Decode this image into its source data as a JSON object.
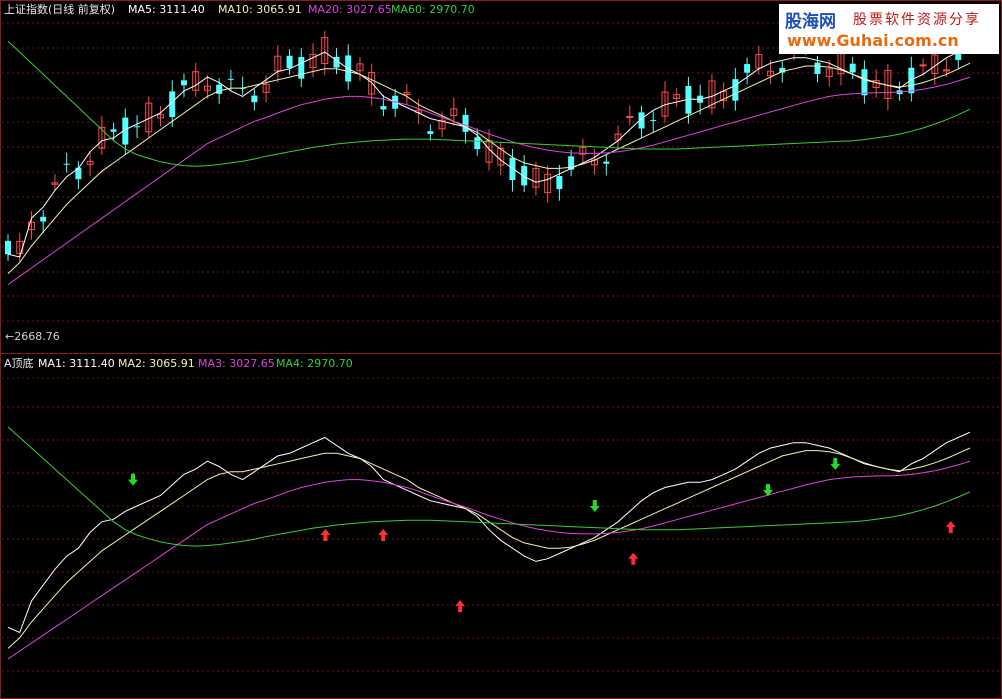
{
  "top_header": {
    "title": "上证指数(日线 前复权)",
    "ma5": "MA5: 3111.40",
    "ma10": "MA10: 3065.91",
    "ma20": "MA20: 3027.65",
    "ma60": "MA60: 2970.70"
  },
  "bottom_header": {
    "title": "A顶底",
    "ma1": "MA1: 3111.40",
    "ma2": "MA2: 3065.91",
    "ma3": "MA3: 3027.65",
    "ma4": "MA4: 2970.70"
  },
  "low_price_label": "←2668.76",
  "watermark": {
    "brand": "股海网",
    "slogan": "股票软件资源分享",
    "url": "www.Guhai.com.cn"
  },
  "colors": {
    "background": "#000000",
    "frame": "#8b1a1a",
    "grid": "#7a1010",
    "up_candle": "#ff4a4a",
    "down_candle": "#54ffff",
    "ma5": "#ffffff",
    "ma10": "#f2f2b0",
    "ma20": "#e040e0",
    "ma60": "#35d035",
    "arrow_up": "#ff3030",
    "arrow_down": "#20e020"
  },
  "chart_data": [
    {
      "type": "candlestick",
      "title": "上证指数(日线 前复权)",
      "price_min_label": 2668.76,
      "ylim": [
        2640,
        3200
      ],
      "series": [
        {
          "name": "MA5",
          "values": [
            2795,
            2790,
            2860,
            2880,
            2910,
            2935,
            2950,
            2980,
            3000,
            3005,
            3020,
            3030,
            3040,
            3050,
            3070,
            3090,
            3100,
            3115,
            3105,
            3090,
            3080,
            3095,
            3110,
            3125,
            3130,
            3140,
            3150,
            3160,
            3145,
            3130,
            3120,
            3105,
            3080,
            3070,
            3060,
            3050,
            3040,
            3035,
            3030,
            3025,
            3010,
            2985,
            2965,
            2950,
            2935,
            2925,
            2930,
            2940,
            2950,
            2960,
            2970,
            2985,
            3000,
            3020,
            3040,
            3055,
            3065,
            3070,
            3075,
            3075,
            3080,
            3090,
            3100,
            3115,
            3130,
            3140,
            3145,
            3150,
            3150,
            3145,
            3140,
            3130,
            3120,
            3110,
            3105,
            3100,
            3095,
            3110,
            3120,
            3135,
            3150,
            3160,
            3170
          ]
        },
        {
          "name": "MA10",
          "values": [
            2760,
            2780,
            2810,
            2835,
            2860,
            2885,
            2905,
            2925,
            2945,
            2960,
            2975,
            2990,
            3005,
            3020,
            3035,
            3050,
            3065,
            3080,
            3090,
            3095,
            3095,
            3100,
            3105,
            3110,
            3115,
            3120,
            3125,
            3130,
            3130,
            3125,
            3120,
            3110,
            3100,
            3090,
            3080,
            3065,
            3055,
            3045,
            3035,
            3025,
            3015,
            3000,
            2985,
            2970,
            2960,
            2955,
            2950,
            2950,
            2952,
            2958,
            2965,
            2975,
            2985,
            2995,
            3005,
            3015,
            3025,
            3035,
            3045,
            3055,
            3065,
            3075,
            3085,
            3095,
            3105,
            3115,
            3125,
            3130,
            3135,
            3135,
            3133,
            3128,
            3120,
            3112,
            3105,
            3100,
            3097,
            3100,
            3105,
            3112,
            3120,
            3130,
            3140
          ]
        },
        {
          "name": "MA20",
          "values": [
            2740,
            2755,
            2770,
            2785,
            2800,
            2815,
            2830,
            2845,
            2860,
            2875,
            2890,
            2905,
            2920,
            2935,
            2950,
            2965,
            2980,
            2995,
            3005,
            3015,
            3025,
            3035,
            3042,
            3050,
            3058,
            3065,
            3070,
            3075,
            3078,
            3080,
            3080,
            3078,
            3075,
            3070,
            3065,
            3058,
            3050,
            3042,
            3035,
            3028,
            3020,
            3012,
            3005,
            2998,
            2992,
            2987,
            2983,
            2980,
            2978,
            2977,
            2977,
            2978,
            2980,
            2983,
            2987,
            2992,
            2998,
            3004,
            3010,
            3016,
            3022,
            3028,
            3034,
            3040,
            3046,
            3052,
            3058,
            3064,
            3070,
            3075,
            3080,
            3083,
            3085,
            3086,
            3087,
            3087,
            3088,
            3090,
            3093,
            3097,
            3102,
            3108,
            3115
          ]
        },
        {
          "name": "MA60",
          "values": [
            3180,
            3160,
            3140,
            3120,
            3100,
            3080,
            3060,
            3040,
            3020,
            3000,
            2985,
            2975,
            2968,
            2962,
            2958,
            2955,
            2954,
            2955,
            2957,
            2960,
            2963,
            2967,
            2972,
            2976,
            2980,
            2984,
            2988,
            2991,
            2994,
            2996,
            2998,
            3000,
            3001,
            3002,
            3003,
            3003,
            3003,
            3002,
            3001,
            3000,
            2999,
            2998,
            2997,
            2996,
            2995,
            2994,
            2993,
            2992,
            2991,
            2990,
            2989,
            2988,
            2987,
            2986,
            2985,
            2985,
            2985,
            2985,
            2986,
            2987,
            2988,
            2989,
            2990,
            2991,
            2992,
            2993,
            2994,
            2995,
            2996,
            2997,
            2998,
            2999,
            3000,
            3002,
            3005,
            3008,
            3012,
            3017,
            3023,
            3030,
            3038,
            3047,
            3057
          ]
        }
      ]
    },
    {
      "type": "line",
      "title": "A顶底",
      "series": [
        {
          "name": "MA1",
          "values": [
            2800,
            2790,
            2850,
            2880,
            2910,
            2935,
            2950,
            2980,
            3000,
            3005,
            3020,
            3030,
            3040,
            3050,
            3070,
            3090,
            3100,
            3115,
            3105,
            3090,
            3080,
            3095,
            3110,
            3125,
            3130,
            3140,
            3150,
            3160,
            3145,
            3130,
            3120,
            3105,
            3080,
            3070,
            3060,
            3050,
            3040,
            3035,
            3030,
            3025,
            3010,
            2985,
            2965,
            2950,
            2935,
            2925,
            2930,
            2940,
            2950,
            2960,
            2970,
            2985,
            3000,
            3020,
            3040,
            3055,
            3065,
            3070,
            3075,
            3075,
            3080,
            3090,
            3100,
            3115,
            3130,
            3140,
            3145,
            3150,
            3150,
            3145,
            3140,
            3130,
            3120,
            3110,
            3105,
            3100,
            3095,
            3110,
            3120,
            3135,
            3150,
            3160,
            3170
          ]
        },
        {
          "name": "MA2",
          "values": [
            2760,
            2780,
            2810,
            2835,
            2860,
            2885,
            2905,
            2925,
            2945,
            2960,
            2975,
            2990,
            3005,
            3020,
            3035,
            3050,
            3065,
            3080,
            3090,
            3095,
            3095,
            3100,
            3105,
            3110,
            3115,
            3120,
            3125,
            3130,
            3130,
            3125,
            3120,
            3110,
            3100,
            3090,
            3080,
            3065,
            3055,
            3045,
            3035,
            3025,
            3015,
            3000,
            2985,
            2970,
            2960,
            2955,
            2950,
            2950,
            2952,
            2958,
            2965,
            2975,
            2985,
            2995,
            3005,
            3015,
            3025,
            3035,
            3045,
            3055,
            3065,
            3075,
            3085,
            3095,
            3105,
            3115,
            3125,
            3130,
            3135,
            3135,
            3133,
            3128,
            3120,
            3112,
            3105,
            3100,
            3097,
            3100,
            3105,
            3112,
            3120,
            3130,
            3140
          ]
        },
        {
          "name": "MA3",
          "values": [
            2740,
            2755,
            2770,
            2785,
            2800,
            2815,
            2830,
            2845,
            2860,
            2875,
            2890,
            2905,
            2920,
            2935,
            2950,
            2965,
            2980,
            2995,
            3005,
            3015,
            3025,
            3035,
            3042,
            3050,
            3058,
            3065,
            3070,
            3075,
            3078,
            3080,
            3080,
            3078,
            3075,
            3070,
            3065,
            3058,
            3050,
            3042,
            3035,
            3028,
            3020,
            3012,
            3005,
            2998,
            2992,
            2987,
            2983,
            2980,
            2978,
            2977,
            2977,
            2978,
            2980,
            2983,
            2987,
            2992,
            2998,
            3004,
            3010,
            3016,
            3022,
            3028,
            3034,
            3040,
            3046,
            3052,
            3058,
            3064,
            3070,
            3075,
            3080,
            3083,
            3085,
            3086,
            3087,
            3087,
            3088,
            3090,
            3093,
            3097,
            3102,
            3108,
            3115
          ]
        },
        {
          "name": "MA4",
          "values": [
            3180,
            3160,
            3140,
            3120,
            3100,
            3080,
            3060,
            3040,
            3020,
            3000,
            2985,
            2975,
            2968,
            2962,
            2958,
            2955,
            2954,
            2955,
            2957,
            2960,
            2963,
            2967,
            2972,
            2976,
            2980,
            2984,
            2988,
            2991,
            2994,
            2996,
            2998,
            3000,
            3001,
            3002,
            3003,
            3003,
            3003,
            3002,
            3001,
            3000,
            2999,
            2998,
            2997,
            2996,
            2995,
            2994,
            2993,
            2992,
            2991,
            2990,
            2989,
            2988,
            2987,
            2986,
            2985,
            2985,
            2985,
            2985,
            2986,
            2987,
            2988,
            2989,
            2990,
            2991,
            2992,
            2993,
            2994,
            2995,
            2996,
            2997,
            2998,
            2999,
            3000,
            3002,
            3005,
            3008,
            3012,
            3017,
            3023,
            3030,
            3038,
            3047,
            3057
          ]
        }
      ],
      "signals": [
        {
          "type": "down",
          "index": 13,
          "value": 3080
        },
        {
          "type": "up",
          "index": 33,
          "value": 2975
        },
        {
          "type": "up",
          "index": 39,
          "value": 2975
        },
        {
          "type": "up",
          "index": 47,
          "value": 2840
        },
        {
          "type": "down",
          "index": 61,
          "value": 3030
        },
        {
          "type": "up",
          "index": 65,
          "value": 2930
        },
        {
          "type": "down",
          "index": 79,
          "value": 3060
        },
        {
          "type": "down",
          "index": 86,
          "value": 3110
        },
        {
          "type": "up",
          "index": 98,
          "value": 2990
        }
      ]
    }
  ]
}
